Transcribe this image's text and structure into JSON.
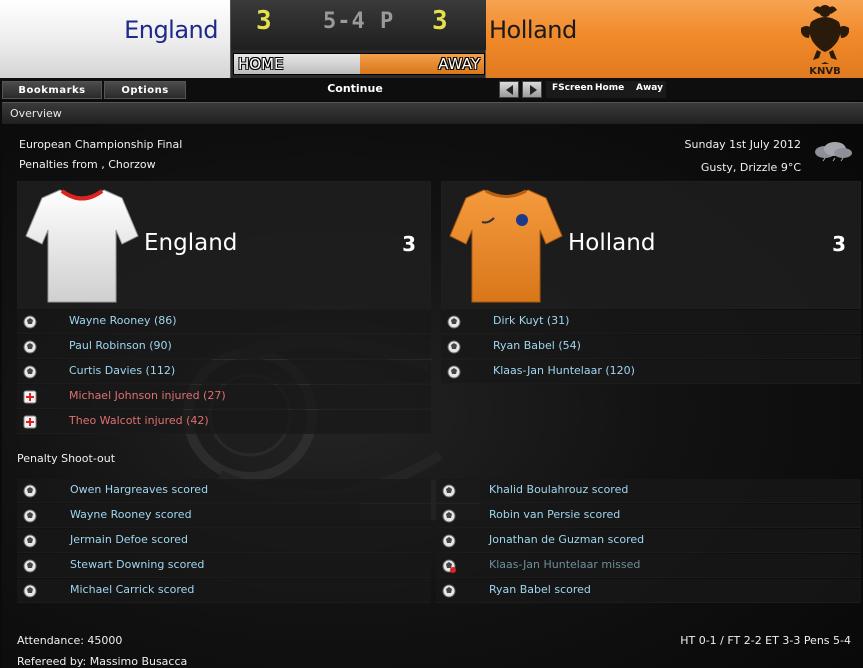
{
  "header": {
    "home_team": "England",
    "away_team": "Holland",
    "home_score": "3",
    "away_score": "3",
    "scoreline": "5-4 P",
    "home_label": "HOME",
    "away_label": "AWAY",
    "crest_text": "KNVB"
  },
  "toolbar": {
    "bookmarks": "Bookmarks",
    "options": "Options",
    "continue": "Continue",
    "fscreen": "FScreen",
    "home": "Home",
    "away": "Away"
  },
  "panel": {
    "title": "Overview"
  },
  "match": {
    "competition": "European Championship Final",
    "venue": "Penalties from , Chorzow",
    "date": "Sunday 1st July 2012",
    "weather": "Gusty, Drizzle 9°C",
    "home": {
      "name": "England",
      "score": "3",
      "events": [
        {
          "text": "Wayne Rooney (86)",
          "icon": "ball-icon",
          "type": "goal"
        },
        {
          "text": "Paul Robinson (90)",
          "icon": "ball-icon",
          "type": "goal"
        },
        {
          "text": "Curtis Davies (112)",
          "icon": "ball-icon",
          "type": "goal"
        },
        {
          "text": "Michael Johnson injured (27)",
          "icon": "injury-icon",
          "type": "injury"
        },
        {
          "text": "Theo Walcott injured (42)",
          "icon": "injury-icon",
          "type": "injury"
        }
      ]
    },
    "away": {
      "name": "Holland",
      "score": "3",
      "events": [
        {
          "text": "Dirk Kuyt (31)",
          "icon": "ball-icon",
          "type": "goal"
        },
        {
          "text": "Ryan Babel (54)",
          "icon": "ball-icon",
          "type": "goal"
        },
        {
          "text": "Klaas-Jan Huntelaar (120)",
          "icon": "ball-icon",
          "type": "goal"
        }
      ]
    }
  },
  "shootout": {
    "title": "Penalty Shoot-out",
    "home": [
      {
        "text": "Owen Hargreaves scored",
        "icon": "ball-icon"
      },
      {
        "text": "Wayne Rooney scored",
        "icon": "ball-icon"
      },
      {
        "text": "Jermain Defoe scored",
        "icon": "ball-icon"
      },
      {
        "text": "Stewart Downing scored",
        "icon": "ball-icon"
      },
      {
        "text": "Michael Carrick scored",
        "icon": "ball-icon"
      }
    ],
    "away": [
      {
        "text": "Khalid Boulahrouz scored",
        "icon": "ball-icon"
      },
      {
        "text": "Robin van Persie scored",
        "icon": "ball-icon"
      },
      {
        "text": "Jonathan de Guzman scored",
        "icon": "ball-icon"
      },
      {
        "text": "Klaas-Jan Huntelaar missed",
        "icon": "missed-ball-icon"
      },
      {
        "text": "Ryan Babel scored",
        "icon": "ball-icon"
      }
    ]
  },
  "footer": {
    "attendance": "Attendance: 45000",
    "referee": "Refereed by: Massimo Busacca",
    "result": "HT 0-1 / FT 2-2 ET 3-3 Pens 5-4"
  },
  "colors": {
    "home_kit": "#ffffff",
    "away_kit": "#f08a2a",
    "link": "#9fd6f0",
    "injury": "#e07070",
    "missed": "#6d8f9b",
    "lcd": "#e6e04a"
  }
}
